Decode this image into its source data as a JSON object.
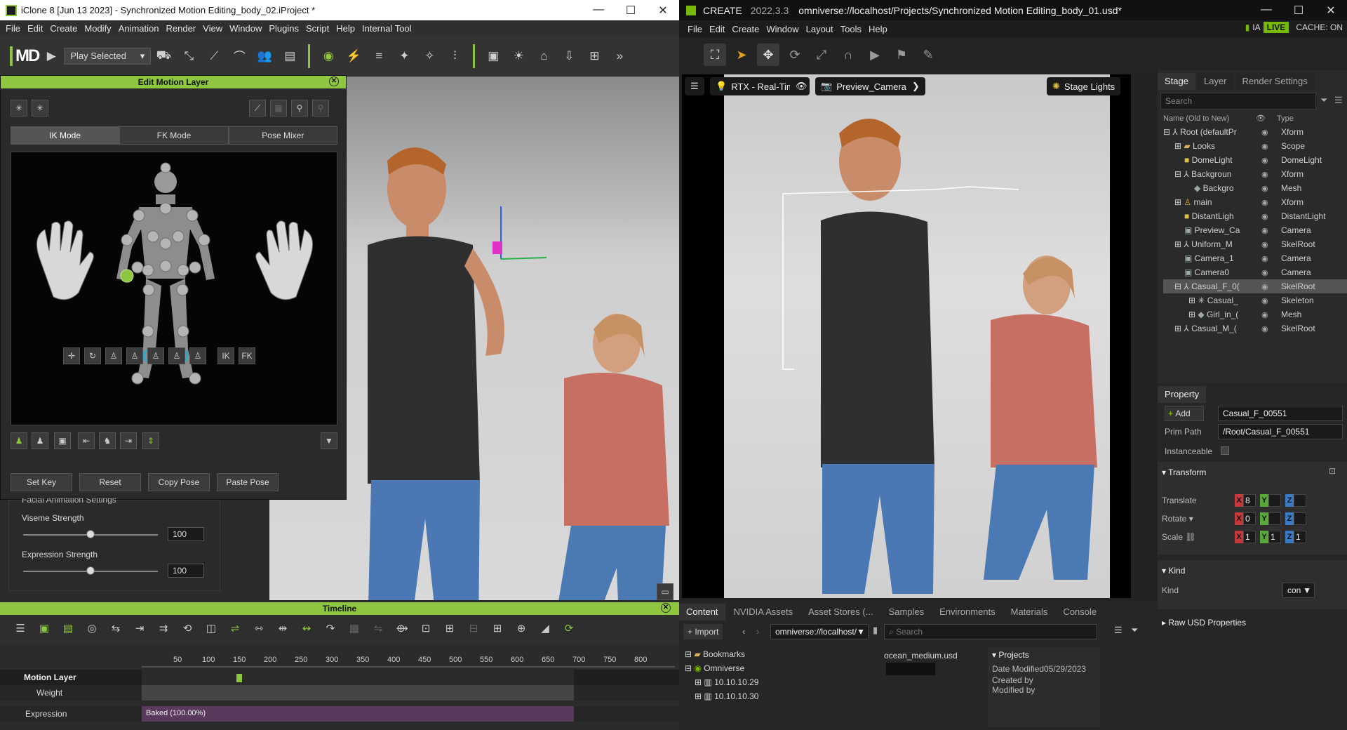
{
  "iclone": {
    "title": "iClone 8 [Jun 13 2023] - Synchronized Motion Editing_body_02.iProject *",
    "menu": [
      "File",
      "Edit",
      "Create",
      "Modify",
      "Animation",
      "Render",
      "View",
      "Window",
      "Plugins",
      "Script",
      "Help",
      "Internal Tool"
    ],
    "logo": "MD",
    "play_mode": "Play Selected",
    "edit_motion_layer": {
      "title": "Edit Motion Layer",
      "modes": [
        "IK Mode",
        "FK Mode",
        "Pose Mixer"
      ],
      "active_mode": "IK Mode",
      "ik_label": "IK",
      "fk_label": "FK",
      "buttons": [
        "Set Key",
        "Reset",
        "Copy Pose",
        "Paste Pose"
      ]
    },
    "facial": {
      "header_partial": "Facial Animation Settings",
      "viseme_label": "Viseme Strength",
      "viseme_value": "100",
      "viseme_level": 0.5,
      "expression_label": "Expression Strength",
      "expression_value": "100",
      "expression_level": 0.5
    },
    "timeline": {
      "title": "Timeline",
      "ticks": [
        "50",
        "100",
        "150",
        "200",
        "250",
        "300",
        "350",
        "400",
        "450",
        "500",
        "550",
        "600",
        "650",
        "700",
        "750",
        "800"
      ],
      "tracks": [
        {
          "label": "Motion Layer"
        },
        {
          "label": "Weight"
        },
        {
          "label": "Expression",
          "clip": "Baked (100.00%)"
        }
      ]
    }
  },
  "omni": {
    "app": "CREATE",
    "version": "2022.3.3",
    "path": "omniverse://localhost/Projects/Synchronized Motion Editing_body_01.usd*",
    "menu": [
      "File",
      "Edit",
      "Create",
      "Window",
      "Layout",
      "Tools",
      "Help"
    ],
    "status": {
      "ia": "IA",
      "live": "LIVE",
      "cache": "CACHE: ON"
    },
    "viewport": {
      "renderer": "RTX - Real-Time",
      "camera": "Preview_Camera",
      "lights": "Stage Lights"
    },
    "stage": {
      "tabs": [
        "Stage",
        "Layer",
        "Render Settings"
      ],
      "search_placeholder": "Search",
      "col_name": "Name (Old to New)",
      "col_type": "Type",
      "rows": [
        {
          "name": "Root (defaultPr",
          "type": "Xform"
        },
        {
          "name": "Looks",
          "type": "Scope"
        },
        {
          "name": "DomeLight",
          "type": "DomeLight"
        },
        {
          "name": "Backgroun",
          "type": "Xform"
        },
        {
          "name": "Backgro",
          "type": "Mesh"
        },
        {
          "name": "main",
          "type": "Xform"
        },
        {
          "name": "DistantLigh",
          "type": "DistantLight"
        },
        {
          "name": "Preview_Ca",
          "type": "Camera"
        },
        {
          "name": "Uniform_M",
          "type": "SkelRoot"
        },
        {
          "name": "Camera_1",
          "type": "Camera"
        },
        {
          "name": "Camera0",
          "type": "Camera"
        },
        {
          "name": "Casual_F_0(",
          "type": "SkelRoot"
        },
        {
          "name": "Casual_",
          "type": "Skeleton"
        },
        {
          "name": "Girl_in_(",
          "type": "Mesh"
        },
        {
          "name": "Casual_M_(",
          "type": "SkelRoot"
        }
      ]
    },
    "property": {
      "tab": "Property",
      "add_label": "Add",
      "name_value": "Casual_F_00551",
      "prim_path_label": "Prim Path",
      "prim_path": "/Root/Casual_F_00551",
      "instanceable_label": "Instanceable",
      "transform_label": "Transform",
      "translate_label": "Translate",
      "rotate_label": "Rotate",
      "scale_label": "Scale",
      "translate": [
        "8",
        "",
        ""
      ],
      "rotate": [
        "0",
        "",
        ""
      ],
      "scale": [
        "1",
        "1",
        "1"
      ],
      "kind_section": "Kind",
      "kind_label": "Kind",
      "kind_value": "con",
      "raw_usd": "Raw USD Properties"
    },
    "content": {
      "tabs": [
        "Content",
        "NVIDIA Assets",
        "Asset Stores (...",
        "Samples",
        "Environments",
        "Materials",
        "Console"
      ],
      "import_label": "Import",
      "path": "omniverse://localhost/",
      "search_placeholder": "Search",
      "tree": [
        "Bookmarks",
        "Omniverse",
        "10.10.10.29",
        "10.10.10.30"
      ],
      "file_name": "ocean_medium.usd",
      "projects_label": "Projects",
      "date_modified": "Date Modified05/29/2023",
      "created_by": "Created by",
      "modified_by": "Modified by"
    }
  },
  "colors": {
    "iclone_accent": "#8ec63f",
    "omni_accent": "#76b900",
    "selection": "#555555"
  }
}
